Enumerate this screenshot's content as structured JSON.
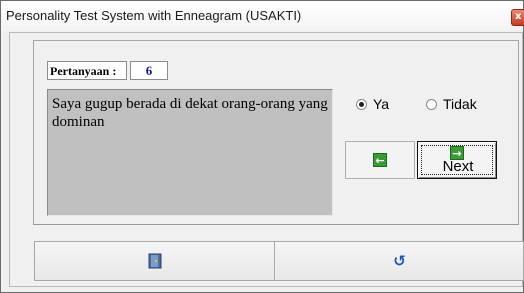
{
  "window": {
    "title": "Personality Test System with Enneagram (USAKTI)",
    "close_icon": "close-icon",
    "close_glyph": "x"
  },
  "question": {
    "label": "Pertanyaan :",
    "number": "6",
    "text": "Saya gugup berada di dekat orang-orang yang dominan"
  },
  "answers": {
    "yes_label": "Ya",
    "no_label": "Tidak",
    "selected": "Ya"
  },
  "navigation": {
    "back_icon": "arrow-left-icon",
    "back_glyph": "←",
    "next_icon": "arrow-right-icon",
    "next_glyph": "→",
    "next_label": "Next"
  },
  "footer": {
    "exit_icon": "door-exit-icon",
    "reset_icon": "refresh-icon",
    "reset_glyph": "↺"
  },
  "colors": {
    "question_number": "#1a1a80",
    "question_background": "#c0c0c0",
    "arrow_green": "#3b9a38",
    "refresh_blue": "#1f55b5",
    "close_red": "#c43c22"
  }
}
